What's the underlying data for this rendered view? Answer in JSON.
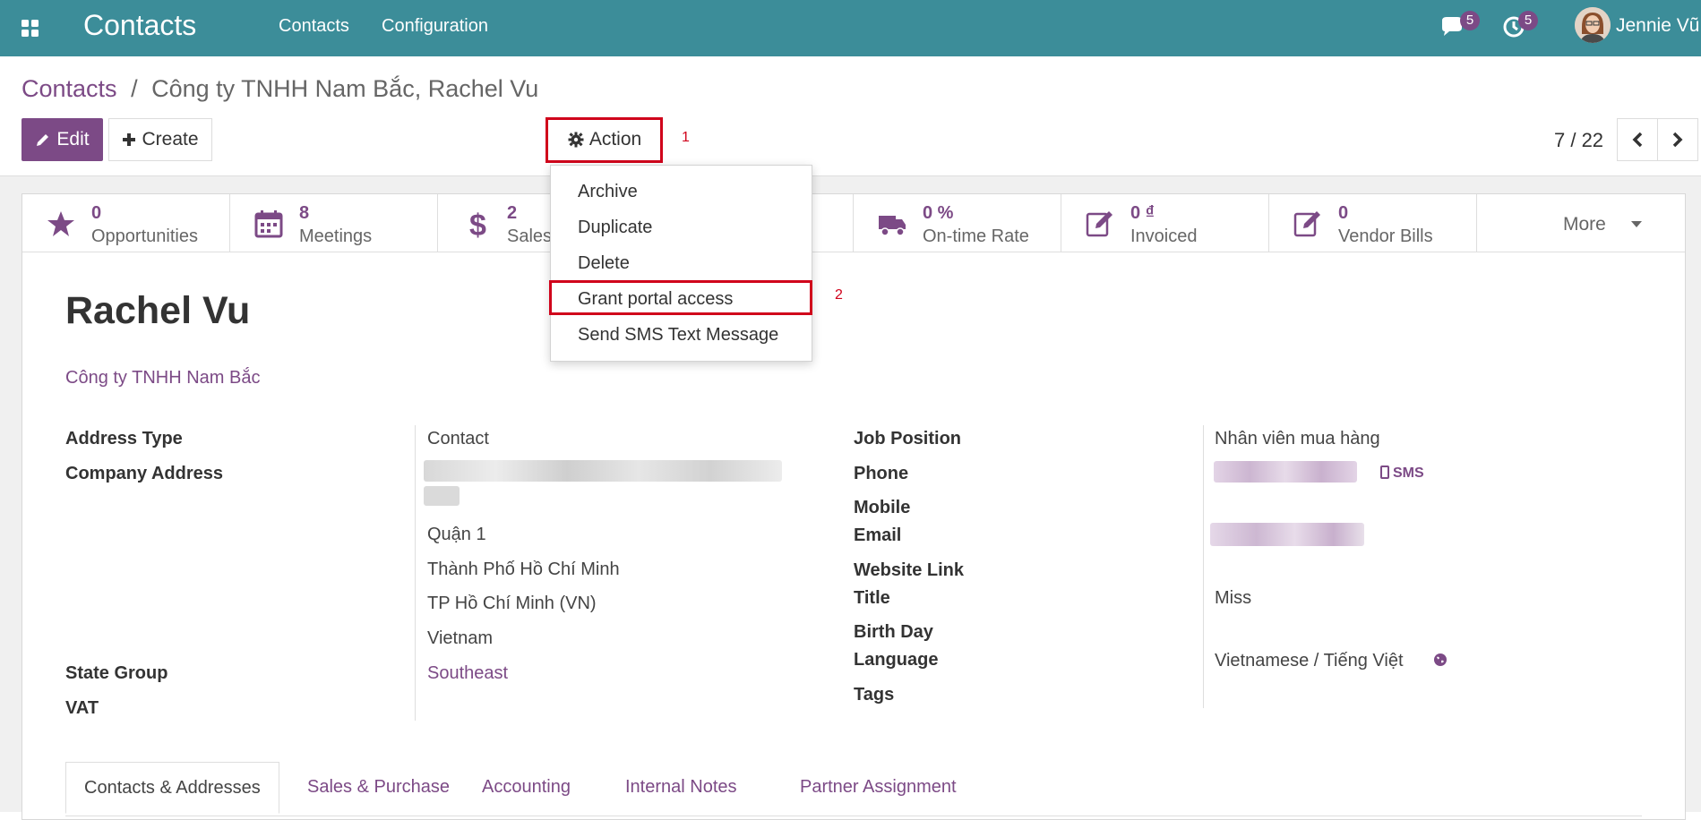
{
  "navbar": {
    "app_title": "Contacts",
    "menu": [
      "Contacts",
      "Configuration"
    ],
    "messages_count": "5",
    "activities_count": "5",
    "user_name": "Jennie Vũ",
    "color": "#3c8d99"
  },
  "breadcrumb": {
    "parent": "Contacts",
    "separator": "/",
    "current": "Công ty TNHH Nam Bắc, Rachel Vu"
  },
  "toolbar": {
    "edit_label": "Edit",
    "create_label": "Create",
    "action_label": "Action",
    "annotation_1": "1",
    "annotation_2": "2",
    "pager": "7 / 22"
  },
  "action_menu": {
    "items": [
      "Archive",
      "Duplicate",
      "Delete",
      "Grant portal access",
      "Send SMS Text Message"
    ]
  },
  "stat_buttons": [
    {
      "value": "0",
      "label": "Opportunities",
      "icon": "star-icon"
    },
    {
      "value": "8",
      "label": "Meetings",
      "icon": "calendar-icon"
    },
    {
      "value": "2",
      "label": "Sales",
      "icon": "dollar-icon"
    },
    {
      "value": "0 %",
      "label": "On-time Rate",
      "icon": "truck-icon"
    },
    {
      "value": "0 ₫",
      "label": "Invoiced",
      "icon": "edit-icon"
    },
    {
      "value": "0",
      "label": "Vendor Bills",
      "icon": "edit-icon"
    }
  ],
  "more_label": "More",
  "partner": {
    "name": "Rachel Vu",
    "company": "Công ty TNHH Nam Bắc"
  },
  "left_fields": {
    "address_type_label": "Address Type",
    "address_type_value": "Contact",
    "company_address_label": "Company Address",
    "district": "Quận 1",
    "city": "Thành Phố Hồ Chí Minh",
    "state": "TP Hồ Chí Minh (VN)",
    "country": "Vietnam",
    "state_group_label": "State Group",
    "state_group_value": "Southeast",
    "vat_label": "VAT"
  },
  "right_fields": {
    "job_position_label": "Job Position",
    "job_position_value": "Nhân viên mua hàng",
    "phone_label": "Phone",
    "sms_label": "SMS",
    "mobile_label": "Mobile",
    "email_label": "Email",
    "website_label": "Website Link",
    "title_label": "Title",
    "title_value": "Miss",
    "birthday_label": "Birth Day",
    "language_label": "Language",
    "language_value": "Vietnamese / Tiếng Việt",
    "tags_label": "Tags"
  },
  "tabs": [
    "Contacts & Addresses",
    "Sales & Purchase",
    "Accounting",
    "Internal Notes",
    "Partner Assignment"
  ],
  "colors": {
    "primary": "#7c4a86",
    "annotation_red": "#d0021b"
  }
}
